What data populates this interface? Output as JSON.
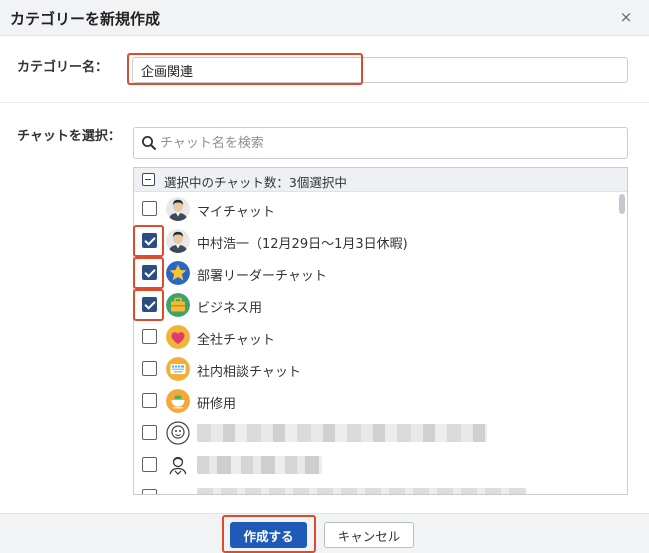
{
  "dialog": {
    "title": "カテゴリーを新規作成",
    "close_symbol": "×"
  },
  "category_name": {
    "label": "カテゴリー名：",
    "value": "企画関連"
  },
  "chat_select": {
    "label": "チャットを選択：",
    "search_placeholder": "チャット名を検索",
    "header_text": "選択中のチャット数：3個選択中",
    "items": [
      {
        "label": "マイチャット",
        "checked": false,
        "icon": "person-photo-avatar"
      },
      {
        "label": "中村浩一（12月29日〜1月3日休暇)",
        "checked": true,
        "icon": "person-photo-avatar"
      },
      {
        "label": "部署リーダーチャット",
        "checked": true,
        "icon": "star-avatar"
      },
      {
        "label": "ビジネス用",
        "checked": true,
        "icon": "briefcase-avatar"
      },
      {
        "label": "全社チャット",
        "checked": false,
        "icon": "heart-avatar"
      },
      {
        "label": "社内相談チャット",
        "checked": false,
        "icon": "keyboard-avatar"
      },
      {
        "label": "研修用",
        "checked": false,
        "icon": "cup-avatar"
      },
      {
        "label": "",
        "checked": false,
        "icon": "sketch-face-avatar"
      },
      {
        "label": "",
        "checked": false,
        "icon": "sketch-person-avatar"
      }
    ]
  },
  "footer": {
    "create_label": "作成する",
    "cancel_label": "キャンセル"
  },
  "colors": {
    "highlight": "#e04a2c",
    "primary": "#1f5ab8",
    "checkbox": "#2a4f7f"
  }
}
